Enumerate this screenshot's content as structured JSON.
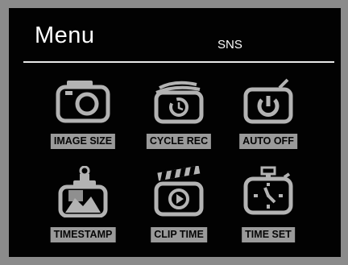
{
  "menu": {
    "title": "Menu",
    "subtitle": "SNS",
    "items": [
      {
        "label": "IMAGE SIZE",
        "icon": "camera-icon"
      },
      {
        "label": "CYCLE REC",
        "icon": "cycle-rec-icon"
      },
      {
        "label": "AUTO OFF",
        "icon": "power-icon"
      },
      {
        "label": "TIMESTAMP",
        "icon": "timestamp-icon"
      },
      {
        "label": "CLIP TIME",
        "icon": "clip-time-icon"
      },
      {
        "label": "TIME SET",
        "icon": "clock-icon"
      }
    ]
  },
  "colors": {
    "frame": "#8b8b8b",
    "screen": "#020202",
    "icon": "#b3b3b3",
    "label_bg": "#9a9a9a",
    "text": "#ffffff"
  }
}
